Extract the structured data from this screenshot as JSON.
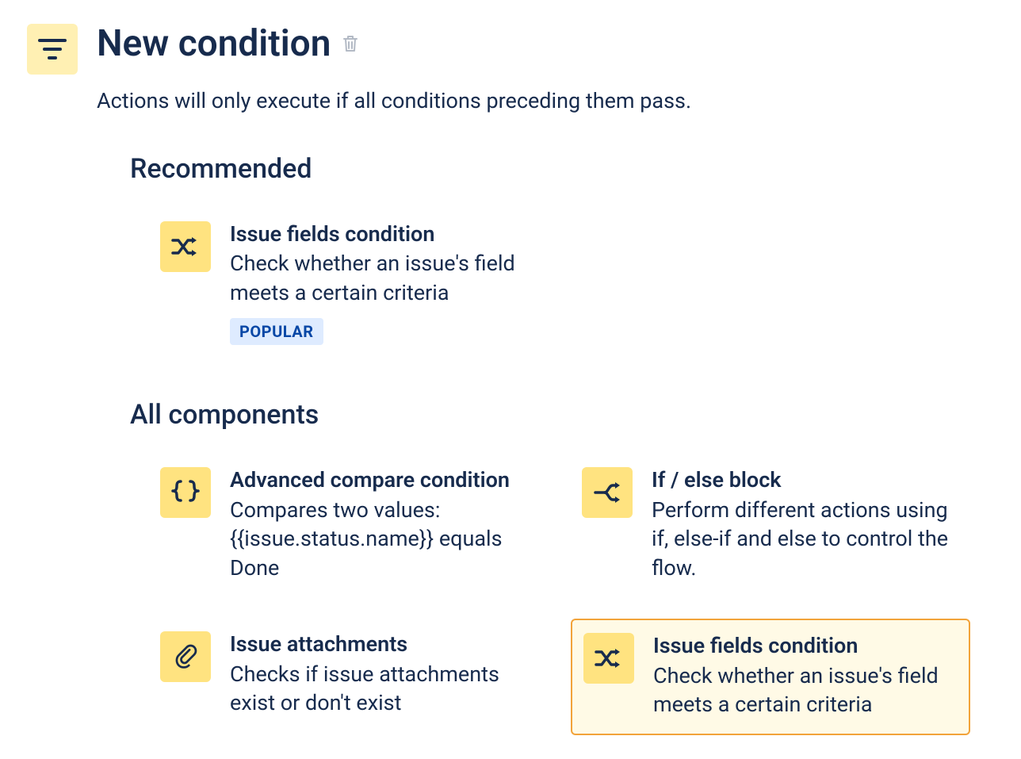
{
  "header": {
    "title": "New condition",
    "subtitle": "Actions will only execute if all conditions preceding them pass."
  },
  "sections": {
    "recommended": {
      "heading": "Recommended",
      "card": {
        "title": "Issue fields condition",
        "desc": "Check whether an issue's field meets a certain criteria",
        "badge": "POPULAR"
      }
    },
    "all": {
      "heading": "All components",
      "cards": [
        {
          "title": "Advanced compare condition",
          "desc": "Compares two values: {{issue.status.name}} equals Done"
        },
        {
          "title": "If / else block",
          "desc": "Perform different actions using if, else-if and else to control the flow."
        },
        {
          "title": "Issue attachments",
          "desc": "Checks if issue attachments exist or don't exist"
        },
        {
          "title": "Issue fields condition",
          "desc": "Check whether an issue's field meets a certain criteria"
        }
      ]
    }
  }
}
